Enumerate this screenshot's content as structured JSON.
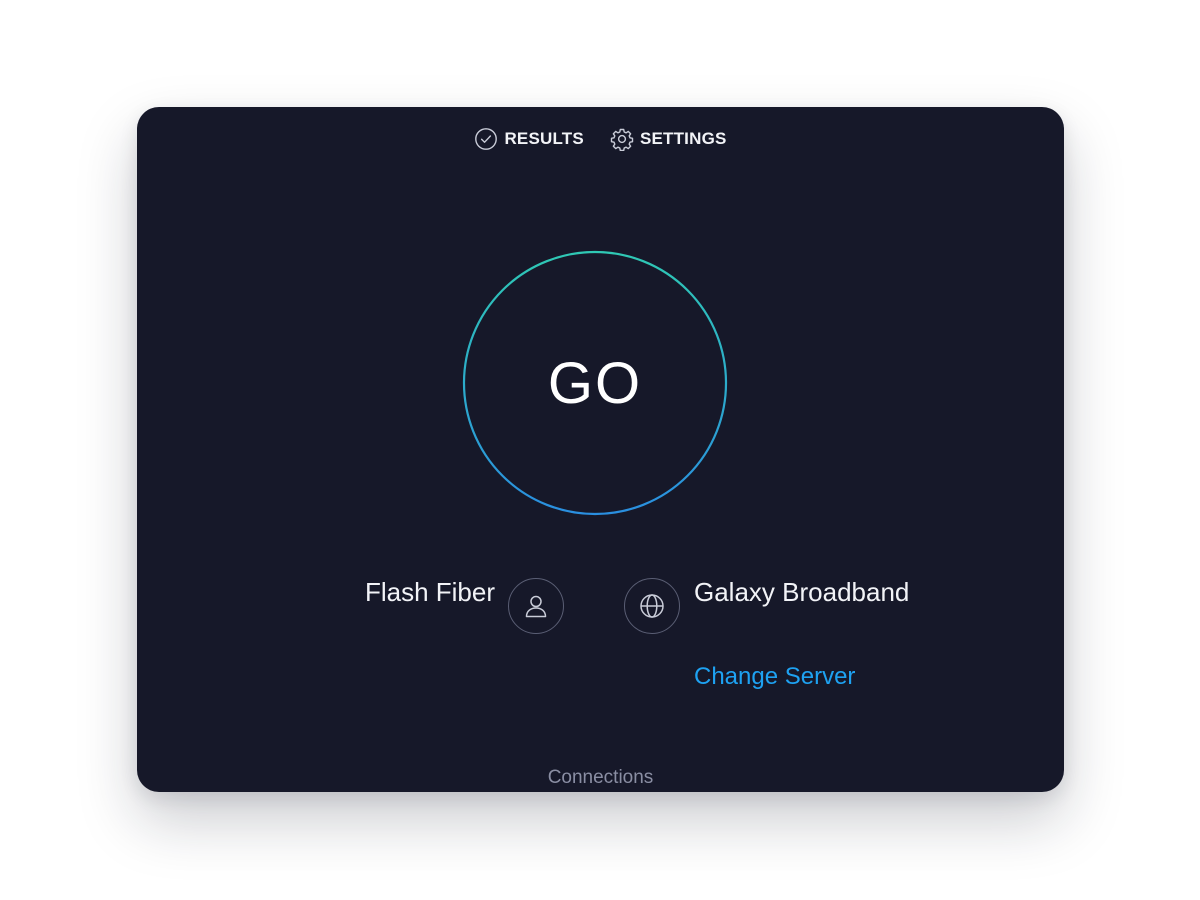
{
  "nav": {
    "results_label": "RESULTS",
    "results_icon": "check-circle-icon",
    "settings_label": "SETTINGS",
    "settings_icon": "gear-icon"
  },
  "go_button": {
    "label": "GO",
    "ring_colors": [
      "#2fc8b4",
      "#2a8fe0"
    ]
  },
  "provider": {
    "isp_name": "Flash Fiber",
    "isp_icon": "person-icon"
  },
  "server": {
    "name": "Galaxy Broadband",
    "icon": "globe-icon",
    "change_label": "Change Server"
  },
  "footer": {
    "connections_label": "Connections"
  },
  "colors": {
    "card_background": "#161829",
    "accent_link": "#1ea2f2"
  }
}
